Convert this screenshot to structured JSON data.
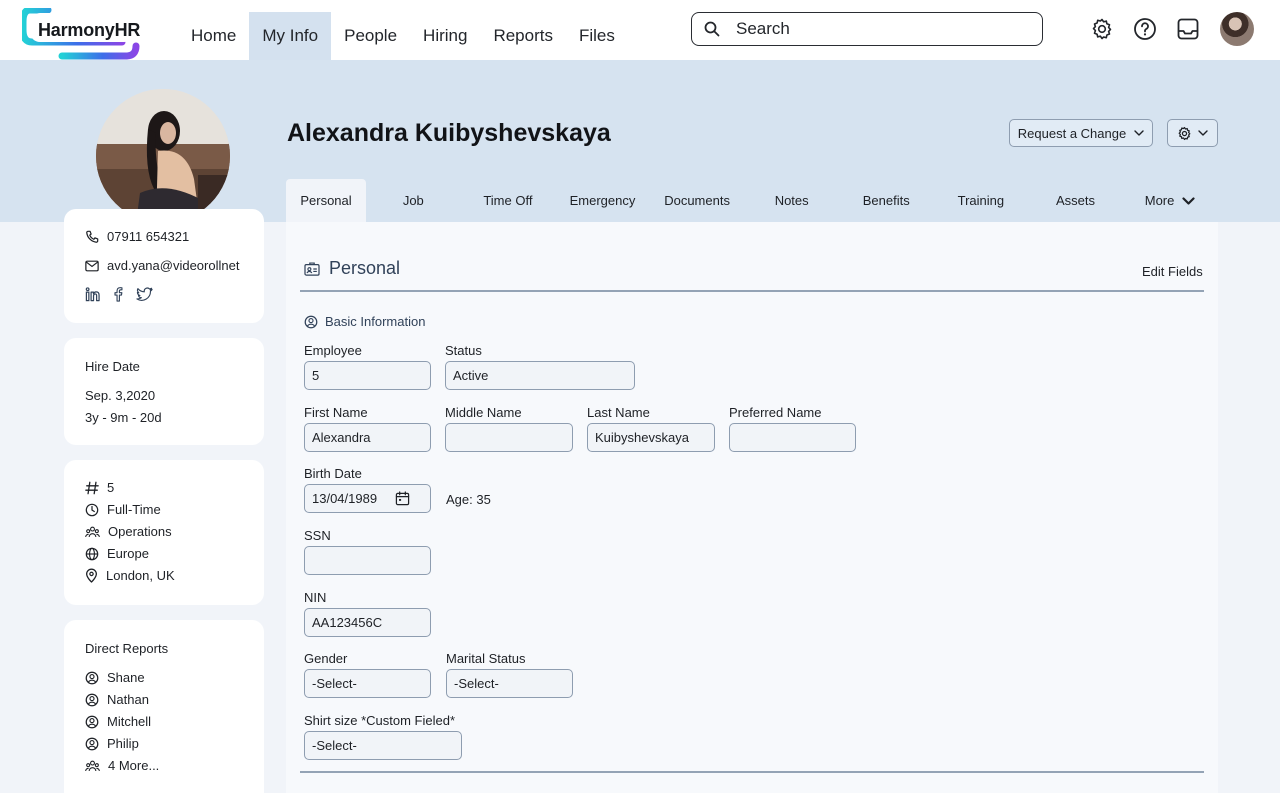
{
  "app": {
    "logo_text": "HarmonyHR",
    "brand_gradient": [
      "#23d1d6",
      "#3d6ee9",
      "#8a46e6"
    ]
  },
  "nav": {
    "items": [
      {
        "label": "Home"
      },
      {
        "label": "My Info"
      },
      {
        "label": "People"
      },
      {
        "label": "Hiring"
      },
      {
        "label": "Reports"
      },
      {
        "label": "Files"
      }
    ],
    "active": "My Info"
  },
  "search": {
    "placeholder": "Search"
  },
  "top_icons": [
    "gear-icon",
    "help-icon",
    "inbox-icon",
    "user-avatar"
  ],
  "employee": {
    "name": "Alexandra Kuibyshevskaya"
  },
  "header_actions": {
    "request_change_label": "Request a Change"
  },
  "tabs": {
    "items": [
      {
        "label": "Personal"
      },
      {
        "label": "Job"
      },
      {
        "label": "Time Off"
      },
      {
        "label": "Emergency"
      },
      {
        "label": "Documents"
      },
      {
        "label": "Notes"
      },
      {
        "label": "Benefits"
      },
      {
        "label": "Training"
      },
      {
        "label": "Assets"
      },
      {
        "label": "More"
      }
    ],
    "active": "Personal"
  },
  "contact": {
    "phone": "07911 654321",
    "email": "avd.yana@videorollnet",
    "socials": [
      "linkedin-icon",
      "facebook-icon",
      "twitter-icon"
    ]
  },
  "hire": {
    "label": "Hire Date",
    "date": "Sep. 3,2020",
    "tenure": "3y - 9m - 20d"
  },
  "job_summary": {
    "employee_number": "5",
    "employment_type": "Full-Time",
    "department": "Operations",
    "region": "Europe",
    "location": "London, UK"
  },
  "direct_reports": {
    "title": "Direct Reports",
    "people": [
      "Shane",
      "Nathan",
      "Mitchell",
      "Philip"
    ],
    "more_label": "4 More..."
  },
  "section": {
    "title": "Personal",
    "edit_label": "Edit Fields",
    "subsection_title": "Basic Information"
  },
  "form": {
    "employee": {
      "label": "Employee",
      "value": "5"
    },
    "status": {
      "label": "Status",
      "value": "Active"
    },
    "first_name": {
      "label": "First Name",
      "value": "Alexandra"
    },
    "middle_name": {
      "label": "Middle Name",
      "value": ""
    },
    "last_name": {
      "label": "Last Name",
      "value": "Kuibyshevskaya"
    },
    "preferred_name": {
      "label": "Preferred Name",
      "value": ""
    },
    "birth_date": {
      "label": "Birth Date",
      "value": "13/04/1989"
    },
    "age": "Age: 35",
    "ssn": {
      "label": "SSN",
      "value": ""
    },
    "nin": {
      "label": "NIN",
      "value": "AA123456C"
    },
    "gender": {
      "label": "Gender",
      "value": "-Select-"
    },
    "marital_status": {
      "label": "Marital Status",
      "value": "-Select-"
    },
    "shirt_size": {
      "label": "Shirt size *Custom Fieled*",
      "value": "-Select-"
    }
  },
  "colors": {
    "band": "#d6e3f0",
    "active_nav": "#d4e1ef",
    "section_title": "#314259",
    "page_bg": "#f1f4f9"
  }
}
